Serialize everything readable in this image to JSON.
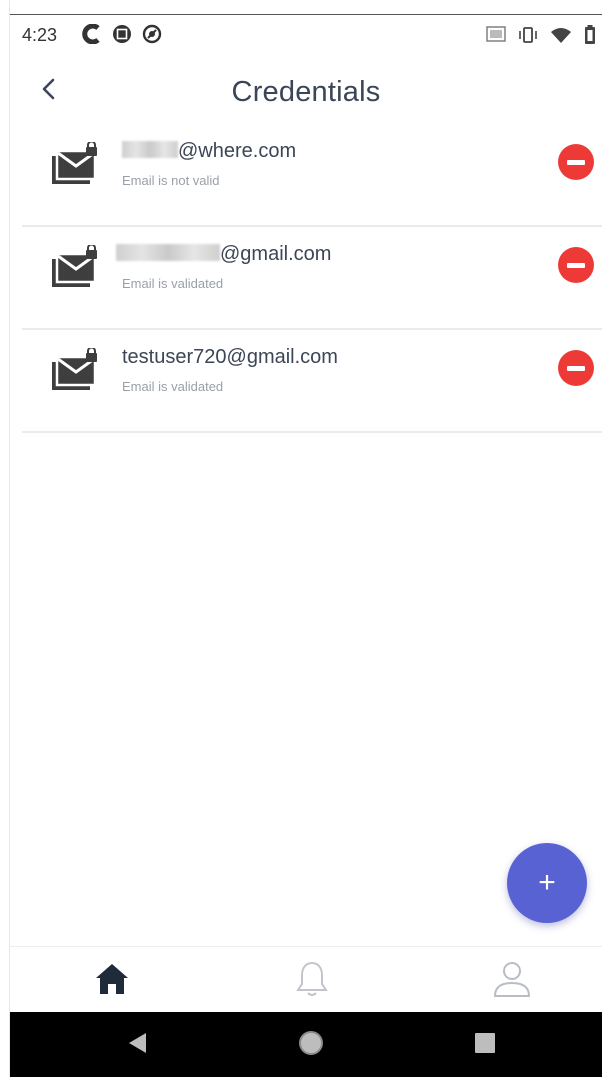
{
  "status_bar": {
    "time": "4:23",
    "left_icons": [
      "c-logo-icon",
      "notification-square-icon",
      "sync-circle-icon"
    ],
    "right_icons": [
      "cast-icon",
      "vibrate-icon",
      "wifi-icon",
      "battery-icon"
    ]
  },
  "header": {
    "title": "Credentials",
    "back_icon": "chevron-left-icon"
  },
  "credentials": [
    {
      "email_suffix": "@where.com",
      "status": "Email is not valid"
    },
    {
      "email_suffix": "@gmail.com",
      "status": "Email is validated"
    },
    {
      "email": "testuser720@gmail.com",
      "status": "Email is validated"
    }
  ],
  "fab": {
    "label": "+"
  },
  "bottom_nav": {
    "items": [
      "home-icon",
      "bell-icon",
      "profile-icon"
    ],
    "active": "home-icon"
  },
  "system_nav": [
    "back-triangle-icon",
    "home-circle-icon",
    "recents-square-icon"
  ],
  "colors": {
    "accent": "#5862d3",
    "remove": "#ee3a37",
    "title": "#3a4557",
    "muted": "#9aa0a8"
  }
}
